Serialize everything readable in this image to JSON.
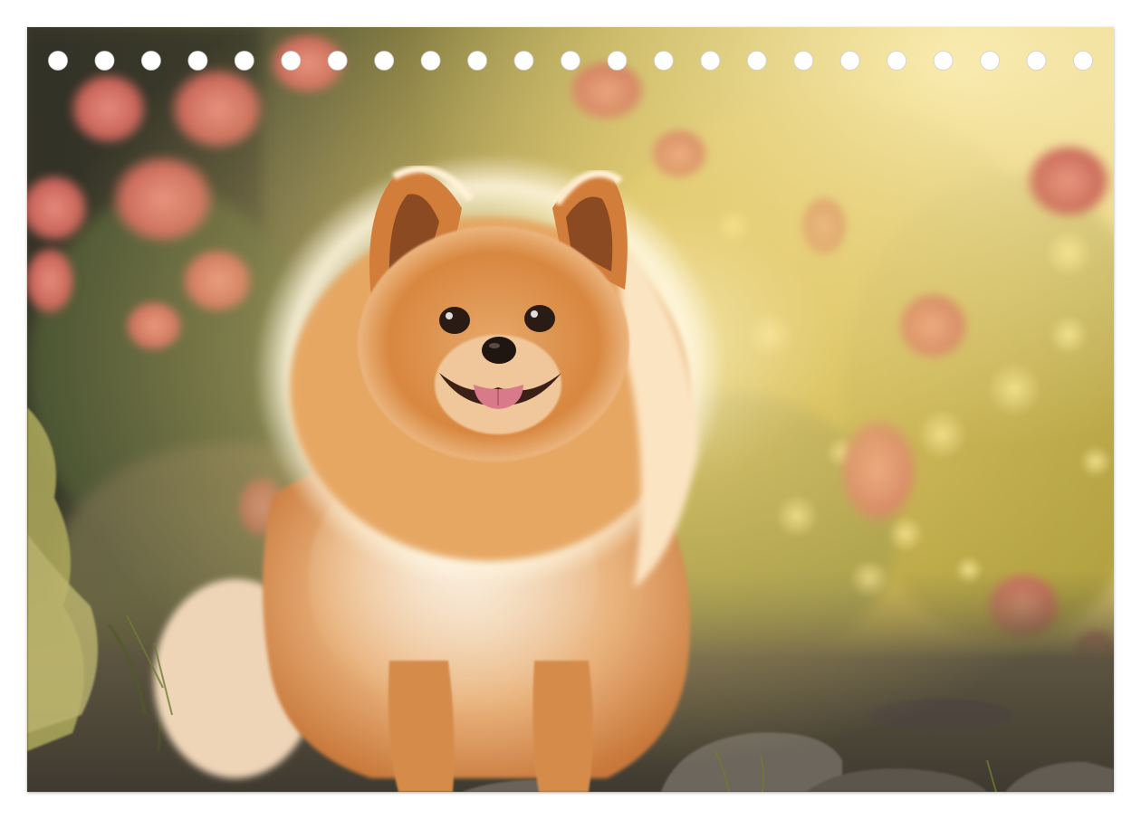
{
  "scene": {
    "subject": "pomeranian-dog",
    "colors": {
      "sunlight": "#fff1b8",
      "foliage": "#b7a23a",
      "blossom": "#d9736a",
      "fur": "#d9853f",
      "ground": "#5e5548"
    }
  },
  "binding": {
    "hole_count": 23
  }
}
